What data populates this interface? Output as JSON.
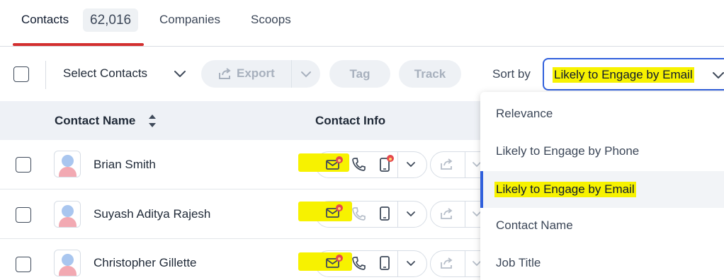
{
  "tabs": {
    "contacts_label": "Contacts",
    "contacts_count": "62,016",
    "companies_label": "Companies",
    "scoops_label": "Scoops"
  },
  "toolbar": {
    "select_label": "Select Contacts",
    "export_label": "Export",
    "tag_label": "Tag",
    "track_label": "Track",
    "sort_label": "Sort by",
    "sort_value": "Likely to Engage by Email"
  },
  "table": {
    "columns": [
      "Contact Name",
      "Contact Info"
    ],
    "rows": [
      {
        "name": "Brian Smith"
      },
      {
        "name": "Suyash Aditya Rajesh"
      },
      {
        "name": "Christopher Gillette"
      }
    ]
  },
  "sort_options": [
    "Relevance",
    "Likely to Engage by Phone",
    "Likely to Engage by Email",
    "Contact Name",
    "Job Title"
  ],
  "colors": {
    "accent": "#2f5fdc",
    "tab_underline": "#d32f2f",
    "highlight": "#f7f200",
    "hot_badge": "#e5484d"
  }
}
